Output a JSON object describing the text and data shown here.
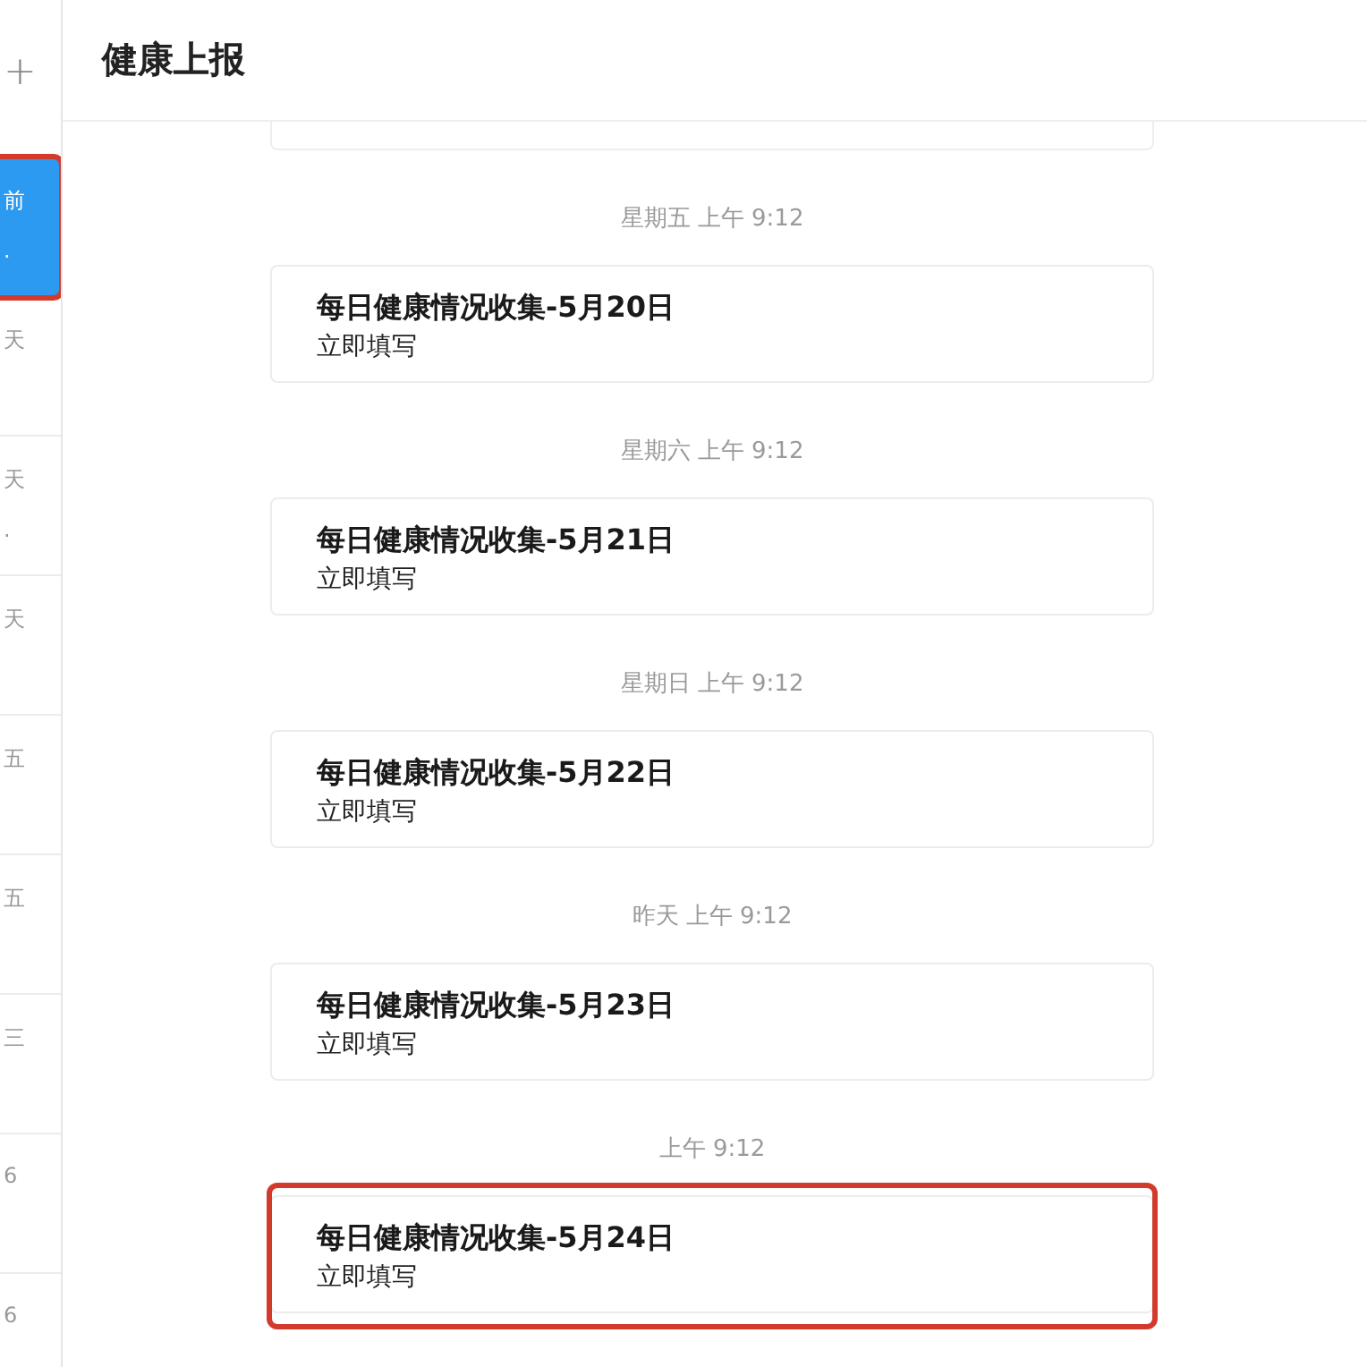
{
  "sidebar": {
    "add_button": "+",
    "items": [
      {
        "time": "前",
        "preview": ".",
        "selected": true,
        "highlighted": true
      },
      {
        "time": "天",
        "selected": false,
        "highlighted": false
      },
      {
        "time": "天",
        "preview": ".",
        "selected": false,
        "highlighted": false
      },
      {
        "time": "天",
        "selected": false,
        "highlighted": false
      },
      {
        "time": "五",
        "selected": false,
        "highlighted": false
      },
      {
        "time": "五",
        "selected": false,
        "highlighted": false
      },
      {
        "time": "三",
        "selected": false,
        "highlighted": false
      },
      {
        "time": "6",
        "selected": false,
        "highlighted": false
      },
      {
        "time": "6",
        "selected": false,
        "highlighted": false
      }
    ]
  },
  "chat": {
    "title": "健康上报",
    "messages": [
      {
        "time": "星期五 上午 9:12",
        "title": "每日健康情况收集-5月20日",
        "action": "立即填写",
        "highlighted": false
      },
      {
        "time": "星期六 上午 9:12",
        "title": "每日健康情况收集-5月21日",
        "action": "立即填写",
        "highlighted": false
      },
      {
        "time": "星期日 上午 9:12",
        "title": "每日健康情况收集-5月22日",
        "action": "立即填写",
        "highlighted": false
      },
      {
        "time": "昨天 上午 9:12",
        "title": "每日健康情况收集-5月23日",
        "action": "立即填写",
        "highlighted": false
      },
      {
        "time": "上午 9:12",
        "title": "每日健康情况收集-5月24日",
        "action": "立即填写",
        "highlighted": true
      }
    ]
  }
}
